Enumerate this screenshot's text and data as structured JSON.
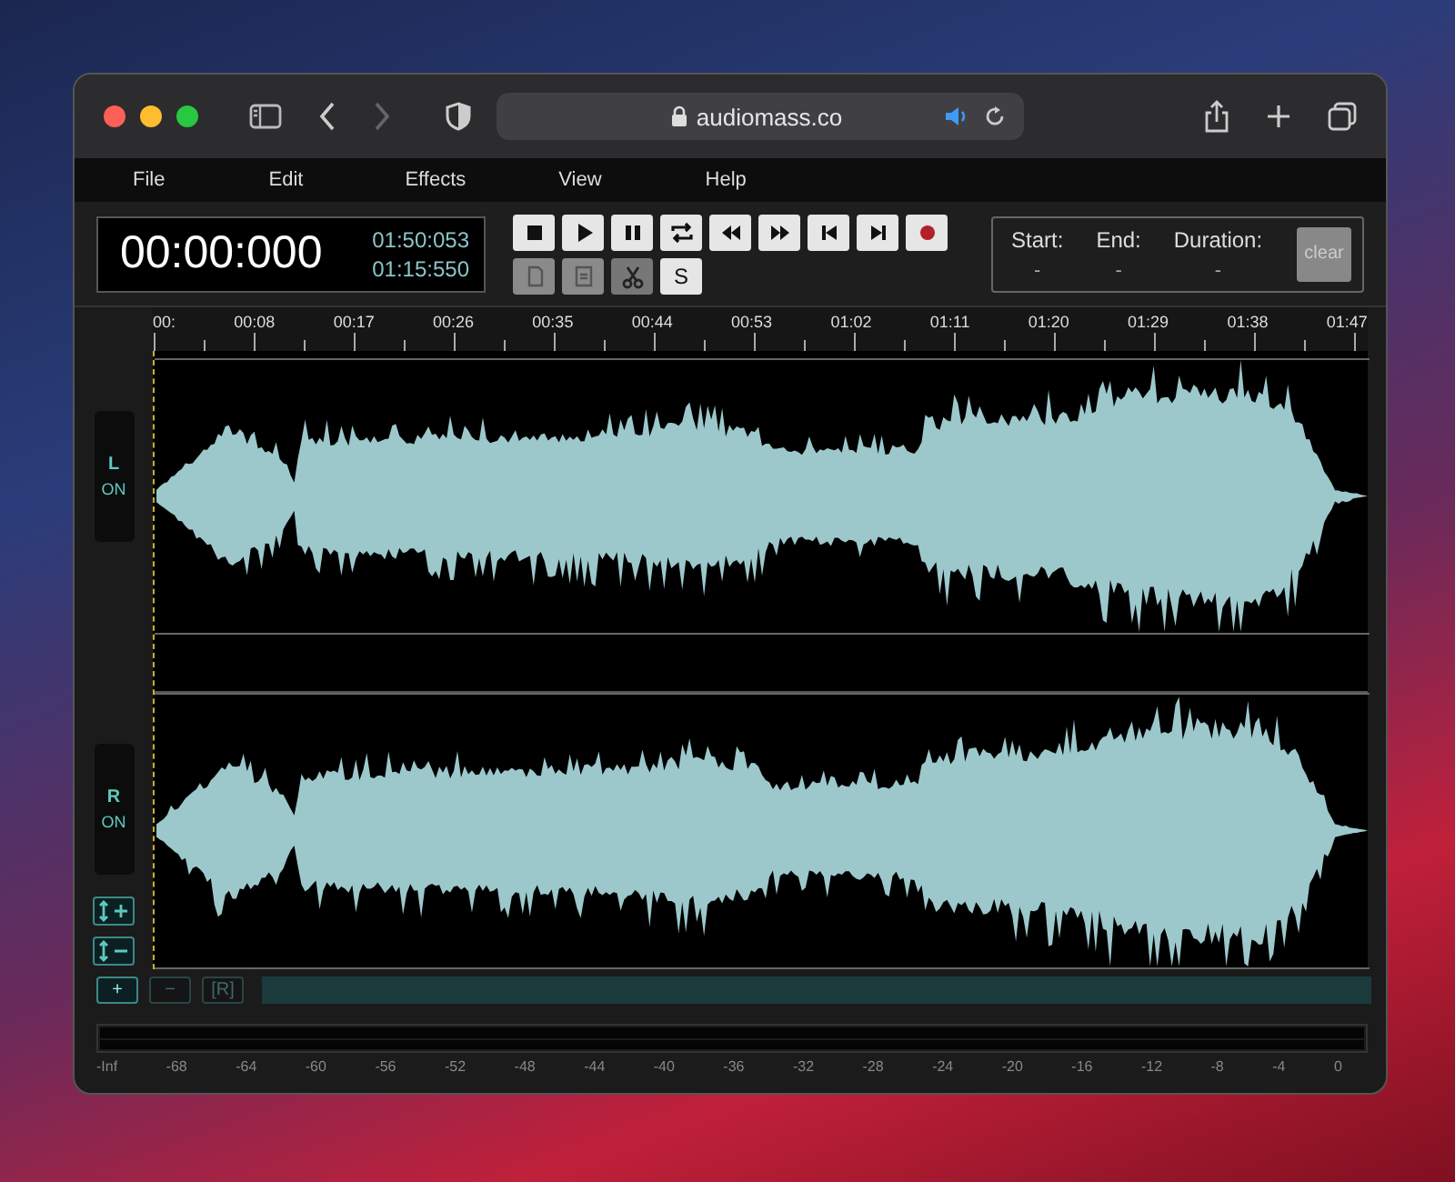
{
  "browser": {
    "url": "audiomass.co"
  },
  "menu": [
    "File",
    "Edit",
    "Effects",
    "View",
    "Help"
  ],
  "timer": {
    "position": "00:00:000",
    "total": "01:50:053",
    "cursor": "01:15:550"
  },
  "transport": [
    {
      "kind": "stop",
      "disabled": false
    },
    {
      "kind": "play",
      "disabled": false
    },
    {
      "kind": "pause",
      "disabled": false
    },
    {
      "kind": "loop",
      "disabled": false
    },
    {
      "kind": "rewind",
      "disabled": false
    },
    {
      "kind": "forward",
      "disabled": false
    },
    {
      "kind": "skip-start",
      "disabled": false
    },
    {
      "kind": "skip-end",
      "disabled": false
    },
    {
      "kind": "record",
      "disabled": false
    }
  ],
  "edit_tools": [
    {
      "kind": "copy",
      "disabled": true
    },
    {
      "kind": "paste",
      "disabled": true
    },
    {
      "kind": "cut",
      "disabled": true
    },
    {
      "kind": "text",
      "label": "S",
      "disabled": false
    }
  ],
  "selection": {
    "fields": [
      {
        "label": "Start:",
        "value": "-"
      },
      {
        "label": "End:",
        "value": "-"
      },
      {
        "label": "Duration:",
        "value": "-"
      }
    ],
    "clear_button": "clear"
  },
  "timeline": [
    "00:",
    "00:08",
    "00:17",
    "00:26",
    "00:35",
    "00:44",
    "00:53",
    "01:02",
    "01:11",
    "01:20",
    "01:29",
    "01:38",
    "01:47"
  ],
  "channels": [
    {
      "label": "L",
      "status": "ON"
    },
    {
      "label": "R",
      "status": "ON"
    }
  ],
  "zoom_buttons": [
    {
      "label": "+",
      "disabled": false
    },
    {
      "label": "−",
      "disabled": true
    },
    {
      "label": "[R]",
      "disabled": true
    }
  ],
  "meter_scale": [
    "-Inf",
    "-68",
    "-64",
    "-60",
    "-56",
    "-52",
    "-48",
    "-44",
    "-40",
    "-36",
    "-32",
    "-28",
    "-24",
    "-20",
    "-16",
    "-12",
    "-8",
    "-4",
    "0"
  ]
}
